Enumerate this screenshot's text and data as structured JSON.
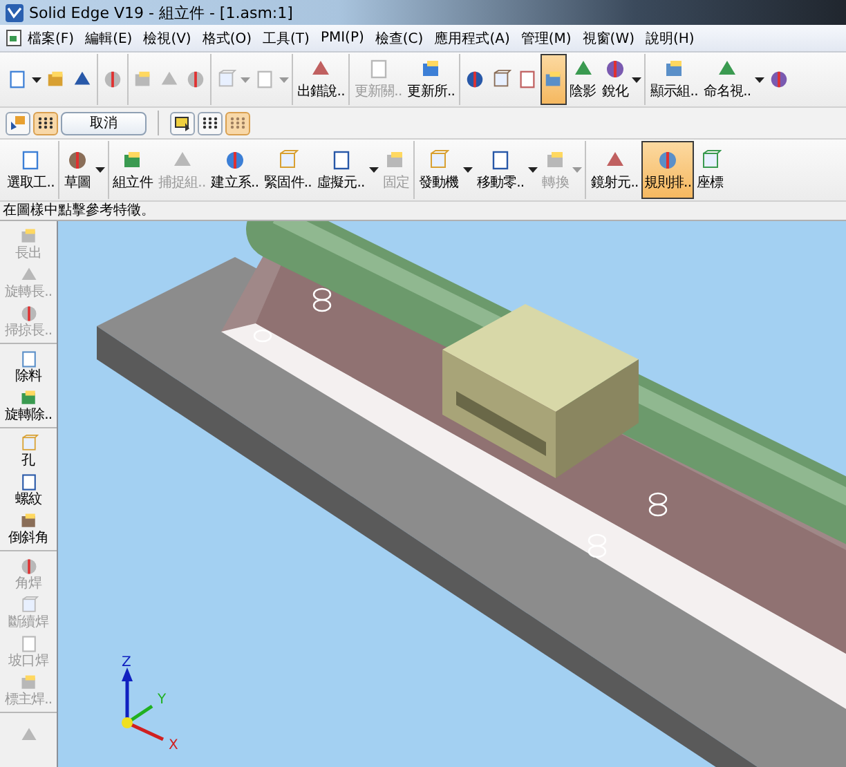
{
  "window": {
    "title": "Solid Edge V19 - 組立件 - [1.asm:1]"
  },
  "menu": [
    "檔案(F)",
    "編輯(E)",
    "檢視(V)",
    "格式(O)",
    "工具(T)",
    "PMI(P)",
    "檢查(C)",
    "應用程式(A)",
    "管理(M)",
    "視窗(W)",
    "說明(H)"
  ],
  "main_toolbar": [
    [
      {
        "disabled": false,
        "selected": false,
        "dropdown": true
      },
      {
        "disabled": false,
        "selected": false,
        "dropdown": false
      },
      {
        "disabled": false,
        "selected": false,
        "dropdown": false
      }
    ],
    [
      {
        "disabled": true,
        "selected": false,
        "dropdown": false
      }
    ],
    [
      {
        "disabled": true,
        "selected": false,
        "dropdown": false
      },
      {
        "disabled": true,
        "selected": false,
        "dropdown": false
      },
      {
        "disabled": true,
        "selected": false,
        "dropdown": false
      }
    ],
    [
      {
        "disabled": true,
        "selected": false,
        "dropdown": true
      },
      {
        "disabled": true,
        "selected": false,
        "dropdown": true
      }
    ],
    [
      {
        "label": "出錯說..",
        "disabled": false,
        "selected": false,
        "dropdown": false
      }
    ],
    [
      {
        "label": "更新關..",
        "disabled": true,
        "selected": false,
        "dropdown": false
      },
      {
        "label": "更新所..",
        "disabled": false,
        "selected": false,
        "dropdown": false
      }
    ],
    [
      {
        "disabled": false,
        "selected": false,
        "dropdown": false
      },
      {
        "disabled": false,
        "selected": false,
        "dropdown": false
      },
      {
        "disabled": false,
        "selected": false,
        "dropdown": false
      },
      {
        "disabled": false,
        "selected": true,
        "dropdown": false
      },
      {
        "label": "陰影",
        "disabled": false,
        "selected": false,
        "dropdown": false
      },
      {
        "label": "銳化",
        "disabled": false,
        "selected": false,
        "dropdown": true
      }
    ],
    [
      {
        "label": "顯示組..",
        "disabled": false,
        "selected": false,
        "dropdown": false
      },
      {
        "label": "命名視..",
        "disabled": false,
        "selected": false,
        "dropdown": true
      },
      {
        "disabled": false,
        "selected": false,
        "dropdown": false
      }
    ]
  ],
  "command_bar": {
    "left": [
      {
        "selected": false
      },
      {
        "selected": true
      }
    ],
    "cancel": "取消",
    "right": [
      {
        "selected": false
      },
      {
        "selected": false
      },
      {
        "selected": true
      }
    ]
  },
  "feature_toolbar": [
    [
      {
        "label": "選取工..",
        "disabled": false,
        "selected": false,
        "dropdown": false
      }
    ],
    [
      {
        "label": "草圖",
        "disabled": false,
        "selected": false,
        "dropdown": true
      }
    ],
    [
      {
        "label": "組立件",
        "disabled": false,
        "selected": false,
        "dropdown": false
      },
      {
        "label": "捕捉組..",
        "disabled": true,
        "selected": false,
        "dropdown": false
      },
      {
        "label": "建立系..",
        "disabled": false,
        "selected": false,
        "dropdown": false
      },
      {
        "label": "緊固件..",
        "disabled": false,
        "selected": false,
        "dropdown": false
      },
      {
        "label": "虛擬元..",
        "disabled": false,
        "selected": false,
        "dropdown": true
      },
      {
        "label": "固定",
        "disabled": true,
        "selected": false,
        "dropdown": false
      }
    ],
    [
      {
        "label": "發動機",
        "disabled": false,
        "selected": false,
        "dropdown": true
      },
      {
        "label": "移動零..",
        "disabled": false,
        "selected": false,
        "dropdown": true
      },
      {
        "label": "轉換",
        "disabled": true,
        "selected": false,
        "dropdown": true
      }
    ],
    [
      {
        "label": "鏡射元..",
        "disabled": false,
        "selected": false,
        "dropdown": false
      },
      {
        "label": "規則排..",
        "disabled": false,
        "selected": true,
        "dropdown": false
      },
      {
        "label": "座標",
        "disabled": false,
        "selected": false,
        "dropdown": false
      }
    ]
  ],
  "prompt": "在圖樣中點擊參考特徵。",
  "sidebar": [
    [
      {
        "label": "長出",
        "disabled": true
      },
      {
        "label": "旋轉長..",
        "disabled": true
      },
      {
        "label": "掃掠長..",
        "disabled": true
      }
    ],
    [
      {
        "label": "除料",
        "disabled": false
      },
      {
        "label": "旋轉除..",
        "disabled": false
      }
    ],
    [
      {
        "label": "孔",
        "disabled": false
      },
      {
        "label": "螺紋",
        "disabled": false
      },
      {
        "label": "倒斜角",
        "disabled": false
      }
    ],
    [
      {
        "label": "角焊",
        "disabled": true
      },
      {
        "label": "斷續焊",
        "disabled": true
      },
      {
        "label": "坡口焊",
        "disabled": true
      },
      {
        "label": "標主焊..",
        "disabled": true
      }
    ],
    [
      {
        "disabled": true
      }
    ]
  ],
  "axis_labels": {
    "z": "Z",
    "y": "Y",
    "x": "X"
  }
}
